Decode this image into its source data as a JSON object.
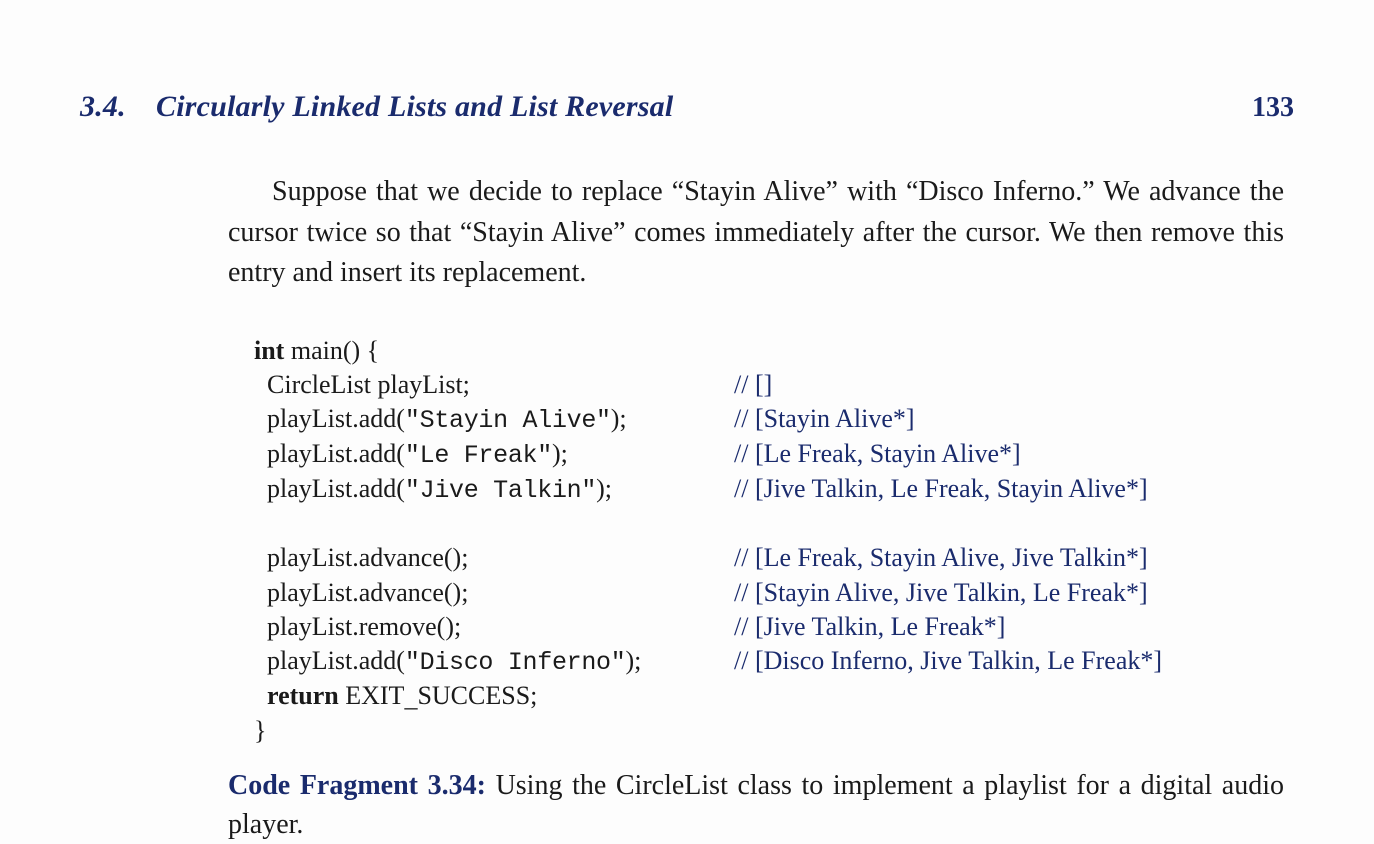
{
  "header": {
    "section_label": "3.4. Circularly Linked Lists and List Reversal",
    "page_number": "133"
  },
  "paragraph": "Suppose that we decide to replace “Stayin Alive” with “Disco Inferno.” We advance the cursor twice so that “Stayin Alive” comes immediately after the cursor. We then remove this entry and insert its replacement.",
  "code": {
    "l0_kw": "int",
    "l0_rest": " main() {",
    "l1": "  CircleList playList;",
    "l1c": "// []",
    "l2": "  playList.add(",
    "l2s": "\"Stayin Alive\"",
    "l2e": ");",
    "l2c": "// [Stayin Alive*]",
    "l3": "  playList.add(",
    "l3s": "\"Le Freak\"",
    "l3e": ");",
    "l3c": "// [Le Freak, Stayin Alive*]",
    "l4": "  playList.add(",
    "l4s": "\"Jive Talkin\"",
    "l4e": ");",
    "l4c": "// [Jive Talkin, Le Freak, Stayin Alive*]",
    "l5": "  playList.advance();",
    "l5c": "// [Le Freak, Stayin Alive, Jive Talkin*]",
    "l6": "  playList.advance();",
    "l6c": "// [Stayin Alive, Jive Talkin, Le Freak*]",
    "l7": "  playList.remove();",
    "l7c": "// [Jive Talkin, Le Freak*]",
    "l8": "  playList.add(",
    "l8s": "\"Disco Inferno\"",
    "l8e": ");",
    "l8c": "// [Disco Inferno, Jive Talkin, Le Freak*]",
    "l9_kw": "  return",
    "l9_a": " EXIT",
    "l9_u": "_",
    "l9_b": "SUCCESS;",
    "l10": "}"
  },
  "caption": {
    "label": "Code Fragment 3.34:",
    "text": " Using the CircleList class to implement a playlist for a digital audio player."
  }
}
